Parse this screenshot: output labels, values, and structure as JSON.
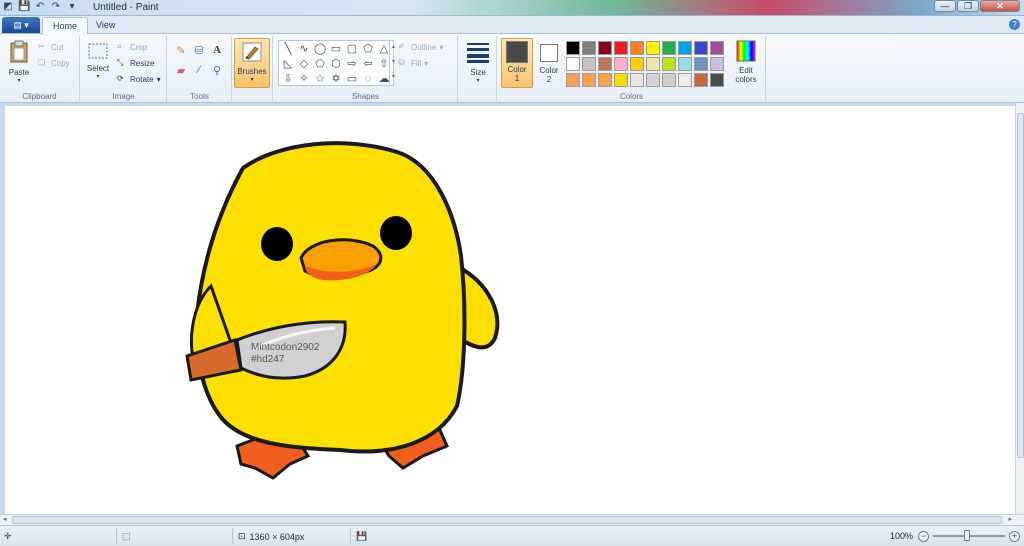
{
  "window": {
    "title": "Untitled - Paint",
    "min_glyph": "—",
    "max_glyph": "❐",
    "close_glyph": "✕"
  },
  "tabs": {
    "file_glyph": "▤ ▾",
    "home": "Home",
    "view": "View",
    "help_glyph": "?"
  },
  "ribbon": {
    "clipboard": {
      "group_label": "Clipboard",
      "paste": "Paste",
      "cut": "Cut",
      "copy": "Copy"
    },
    "image": {
      "group_label": "Image",
      "select": "Select",
      "crop": "Crop",
      "resize": "Resize",
      "rotate": "Rotate"
    },
    "tools": {
      "group_label": "Tools"
    },
    "brushes": {
      "label": "Brushes"
    },
    "shapes": {
      "group_label": "Shapes",
      "outline": "Outline",
      "fill": "Fill"
    },
    "size": {
      "label": "Size"
    },
    "colors": {
      "group_label": "Colors",
      "color1_label": "Color",
      "color1_num": "1",
      "color2_label": "Color",
      "color2_num": "2",
      "edit_colors_line1": "Edit",
      "edit_colors_line2": "colors",
      "color1": "#4a4a4a",
      "color2": "#ffffff",
      "palette": [
        "#000000",
        "#7f7f7f",
        "#880015",
        "#ed1c24",
        "#ff7f27",
        "#fff200",
        "#22b14c",
        "#00a2e8",
        "#3f48cc",
        "#a349a4",
        "#ffffff",
        "#c3c3c3",
        "#b97a57",
        "#ffaec9",
        "#ffc90e",
        "#efe4b0",
        "#b5e61d",
        "#99d9ea",
        "#7092be",
        "#c8bfe7",
        "#f7a24b",
        "#f7a24b",
        "#f7a24b",
        "#f5dd00",
        "#e6e6e6",
        "#d4d4d4",
        "#cfcfcf",
        "#ebebeb",
        "#c8663c",
        "#4a4a4a"
      ]
    }
  },
  "canvas": {
    "watermark_line1": "Mintcodon2902",
    "watermark_line2": "#hd247"
  },
  "statusbar": {
    "dimensions": "1360 × 604px",
    "zoom": "100%"
  }
}
